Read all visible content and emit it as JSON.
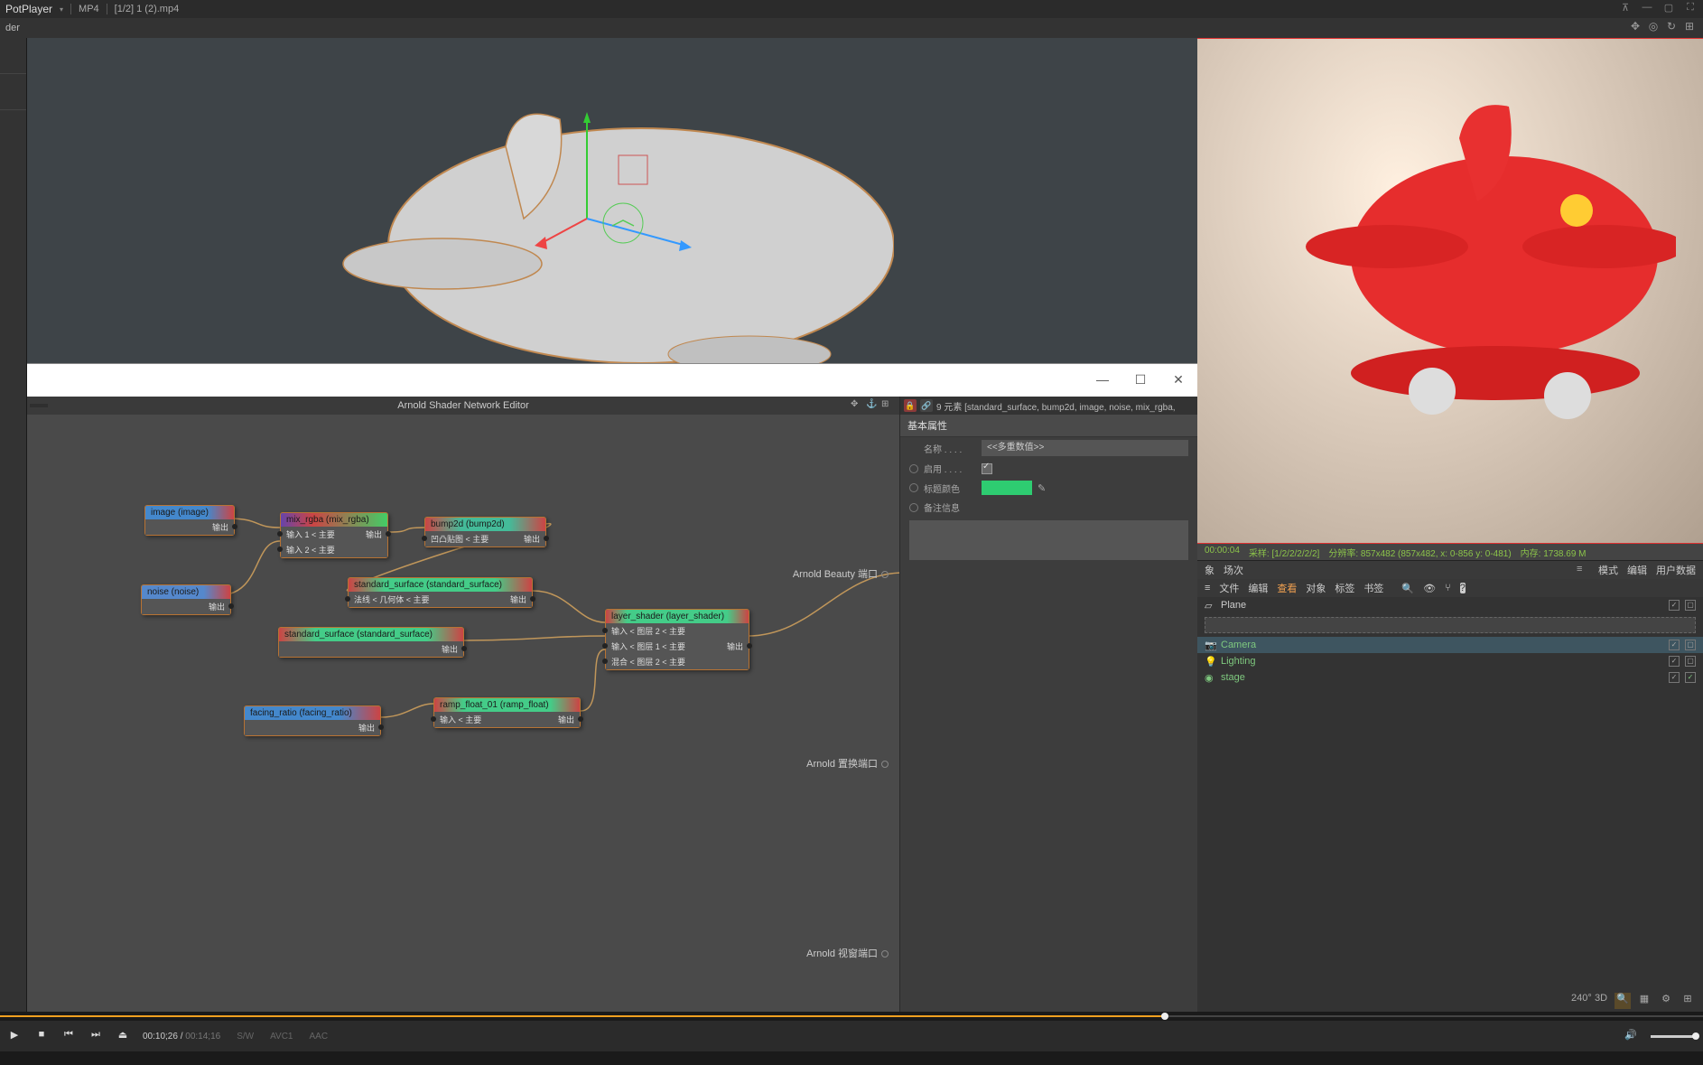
{
  "titlebar": {
    "app": "PotPlayer",
    "format": "MP4",
    "filename": "[1/2] 1 (2).mp4"
  },
  "toolbar2": {
    "label": "der"
  },
  "node_editor": {
    "title": "Arnold Shader Network Editor",
    "outputs": {
      "beauty": "Arnold Beauty 端口",
      "displace": "Arnold 置换端口",
      "viewport": "Arnold 视窗端口"
    }
  },
  "nodes": {
    "image": {
      "title": "image (image)",
      "out": "输出"
    },
    "mix": {
      "title": "mix_rgba (mix_rgba)",
      "in1": "输入 1 < 主要",
      "in2": "输入 2 < 主要",
      "out": "输出"
    },
    "noise": {
      "title": "noise (noise)",
      "out": "输出"
    },
    "bump": {
      "title": "bump2d (bump2d)",
      "in": "凹凸贴图 < 主要",
      "out": "输出"
    },
    "std1": {
      "title": "standard_surface (standard_surface)",
      "in": "法线 < 几何体 < 主要",
      "out": "输出"
    },
    "std2": {
      "title": "standard_surface (standard_surface)",
      "out": "输出"
    },
    "layer": {
      "title": "layer_shader (layer_shader)",
      "in1": "输入 < 图层 2 < 主要",
      "in2": "输入 < 图层 1 < 主要",
      "mix": "混合 < 图层 2 < 主要",
      "out": "输出"
    },
    "facing": {
      "title": "facing_ratio (facing_ratio)",
      "out": "输出"
    },
    "ramp": {
      "title": "ramp_float_01 (ramp_float)",
      "in": "输入 < 主要",
      "out": "输出"
    }
  },
  "props": {
    "header_count": "9 元素",
    "header_list": "[standard_surface, bump2d, image, noise, mix_rgba,",
    "section": "基本属性",
    "name_lbl": "名称 . . . .",
    "name_val": "<<多重数值>>",
    "enable_lbl": "启用 . . . .",
    "color_lbl": "标题颜色",
    "note_lbl": "备注信息",
    "color_hex": "#2ecc71"
  },
  "render_status": {
    "time": "00:00:04",
    "sample_lbl": "采样:",
    "sample": "[1/2/2/2/2/2]",
    "res_lbl": "分辨率:",
    "res": "857x482 (857x482, x: 0-856 y: 0-481)",
    "mem_lbl": "内存:",
    "mem": "1738.69 M"
  },
  "lister": {
    "tabs": {
      "object": "象",
      "scene": "场次"
    },
    "menu": {
      "list": "≡",
      "mode": "模式",
      "edit": "编辑",
      "userdata": "用户数据"
    },
    "row2": {
      "file": "文件",
      "edit": "编辑",
      "view": "查看",
      "object": "对象",
      "tag": "标签",
      "bookmark": "书签"
    },
    "items": [
      {
        "name": "Plane",
        "icon": "plane",
        "hi": false,
        "sel": false
      },
      {
        "name": "Camera",
        "icon": "camera",
        "hi": true,
        "sel": true
      },
      {
        "name": "Lighting",
        "icon": "light",
        "hi": true,
        "sel": false
      },
      {
        "name": "stage",
        "icon": "stage",
        "hi": true,
        "sel": false
      }
    ]
  },
  "player": {
    "cur": "00:10;26",
    "tot": "00:14;16",
    "sw": "S/W",
    "vcodec": "AVC1",
    "acodec": "AAC"
  },
  "bottom_icons": {
    "deg": "240°",
    "three_d": "3D"
  }
}
